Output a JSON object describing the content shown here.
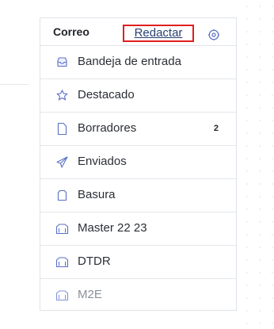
{
  "mail": {
    "title": "Correo",
    "compose_label": "Redactar",
    "settings_icon": "gear-icon",
    "accent_color": "#3f51b5",
    "highlight_color": "#e01e1e",
    "folders": [
      {
        "label": "Bandeja de entrada",
        "icon": "inbox-icon",
        "count": ""
      },
      {
        "label": "Destacado",
        "icon": "star-icon",
        "count": ""
      },
      {
        "label": "Borradores",
        "icon": "draft-icon",
        "count": "2"
      },
      {
        "label": "Enviados",
        "icon": "send-icon",
        "count": ""
      },
      {
        "label": "Basura",
        "icon": "trash-icon",
        "count": ""
      },
      {
        "label": "Master 22 23",
        "icon": "folder-icon",
        "count": ""
      },
      {
        "label": "DTDR",
        "icon": "folder-icon",
        "count": ""
      },
      {
        "label": "M2E",
        "icon": "folder-icon",
        "count": ""
      }
    ]
  }
}
